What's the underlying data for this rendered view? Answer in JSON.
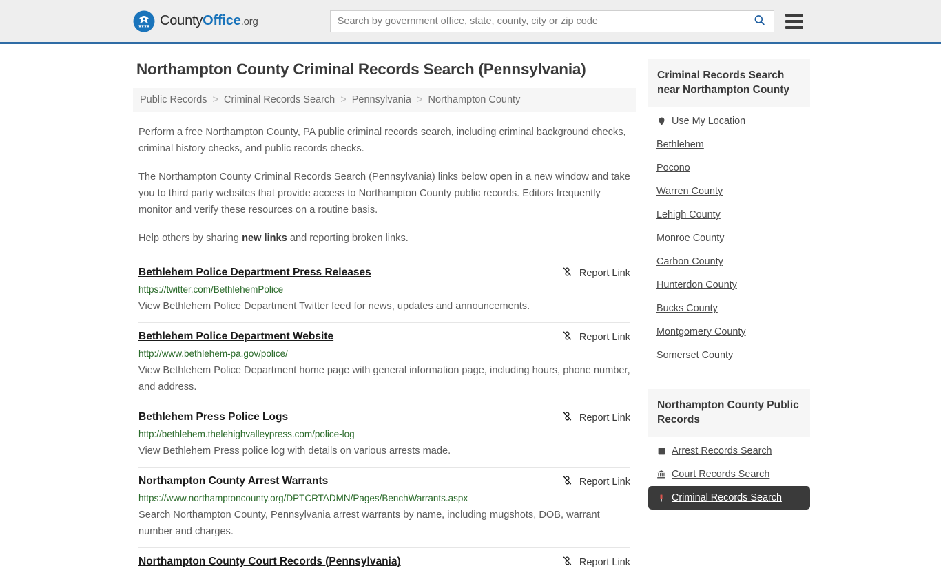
{
  "header": {
    "brand": {
      "part1": "County",
      "part2": "Office",
      "part3": ".org",
      "logo_icon": "eagle-seal-icon"
    },
    "search": {
      "placeholder": "Search by government office, state, county, city or zip code",
      "value": ""
    },
    "search_icon": "search-icon",
    "menu_icon": "hamburger-menu-icon"
  },
  "main": {
    "title": "Northampton County Criminal Records Search (Pennsylvania)",
    "breadcrumb": [
      "Public Records",
      "Criminal Records Search",
      "Pennsylvania",
      "Northampton County"
    ],
    "breadcrumb_separator": ">",
    "intro": {
      "p1": "Perform a free Northampton County, PA public criminal records search, including criminal background checks, criminal history checks, and public records checks.",
      "p2": "The Northampton County Criminal Records Search (Pennsylvania) links below open in a new window and take you to third party websites that provide access to Northampton County public records. Editors frequently monitor and verify these resources on a routine basis.",
      "p3_before": "Help others by sharing ",
      "p3_link": "new links",
      "p3_after": " and reporting broken links."
    },
    "report_link_label": "Report Link",
    "report_link_icon": "broken-link-icon",
    "results": [
      {
        "title": "Bethlehem Police Department Press Releases",
        "url": "https://twitter.com/BethlehemPolice",
        "description": "View Bethlehem Police Department Twitter feed for news, updates and announcements."
      },
      {
        "title": "Bethlehem Police Department Website",
        "url": "http://www.bethlehem-pa.gov/police/",
        "description": "View Bethlehem Police Department home page with general information page, including hours, phone number, and address."
      },
      {
        "title": "Bethlehem Press Police Logs",
        "url": "http://bethlehem.thelehighvalleypress.com/police-log",
        "description": "View Bethlehem Press police log with details on various arrests made."
      },
      {
        "title": "Northampton County Arrest Warrants",
        "url": "https://www.northamptoncounty.org/DPTCRTADMN/Pages/BenchWarrants.aspx",
        "description": "Search Northampton County, Pennsylvania arrest warrants by name, including mugshots, DOB, warrant number and charges."
      },
      {
        "title": "Northampton County Court Records (Pennsylvania)",
        "url": "",
        "description": ""
      }
    ]
  },
  "sidebar": {
    "nearby": {
      "heading": "Criminal Records Search near Northampton County",
      "items": [
        {
          "label": "Use My Location",
          "icon": "map-pin-icon"
        },
        {
          "label": "Bethlehem",
          "icon": ""
        },
        {
          "label": "Pocono",
          "icon": ""
        },
        {
          "label": "Warren County",
          "icon": ""
        },
        {
          "label": "Lehigh County",
          "icon": ""
        },
        {
          "label": "Monroe County",
          "icon": ""
        },
        {
          "label": "Carbon County",
          "icon": ""
        },
        {
          "label": "Hunterdon County",
          "icon": ""
        },
        {
          "label": "Bucks County",
          "icon": ""
        },
        {
          "label": "Montgomery County",
          "icon": ""
        },
        {
          "label": "Somerset County",
          "icon": ""
        }
      ]
    },
    "public_records": {
      "heading": "Northampton County Public Records",
      "items": [
        {
          "label": "Arrest Records Search",
          "icon": "fingerprint-icon",
          "active": false
        },
        {
          "label": "Court Records Search",
          "icon": "courthouse-icon",
          "active": false
        },
        {
          "label": "Criminal Records Search",
          "icon": "gavel-icon",
          "active": true
        }
      ]
    }
  },
  "colors": {
    "accent_blue": "#2f6ca5",
    "brand_blue": "#1a74bb",
    "header_bg": "#eeeeee",
    "url_green": "#2b6b2b",
    "panel_gray": "#f6f6f6",
    "active_dark": "#3a3a3a"
  }
}
